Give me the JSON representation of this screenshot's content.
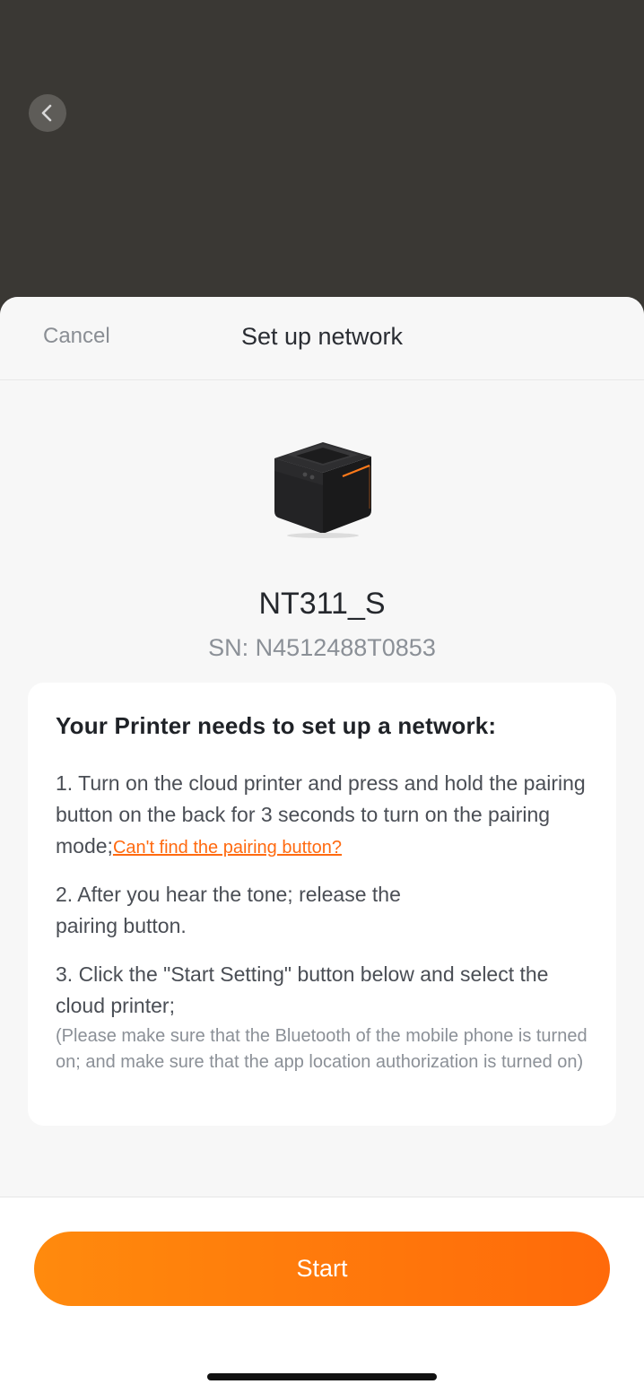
{
  "header": {
    "cancel_label": "Cancel",
    "title": "Set up network"
  },
  "device": {
    "name": "NT311_S",
    "serial": "SN: N4512488T0853"
  },
  "instructions": {
    "title": "Your Printer needs to set up a network:",
    "step1_text": "1. Turn on the cloud printer and press and hold the pairing button on the back for 3 seconds to turn on the pairing mode;",
    "step1_link": "Can't find the pairing button?",
    "step2_text": "2. After you hear the tone; release the pairing button.",
    "step3_text": "3. Click the \"Start Setting\" button below and select the cloud printer;",
    "note": "(Please make sure that the Bluetooth of the mobile phone is turned on; and make sure that the app location authorization is turned on)"
  },
  "footer": {
    "start_label": "Start"
  },
  "colors": {
    "accent": "#ff6a10",
    "backdrop": "#3a3834"
  },
  "icons": {
    "back": "chevron-left-icon",
    "printer": "printer-icon"
  }
}
